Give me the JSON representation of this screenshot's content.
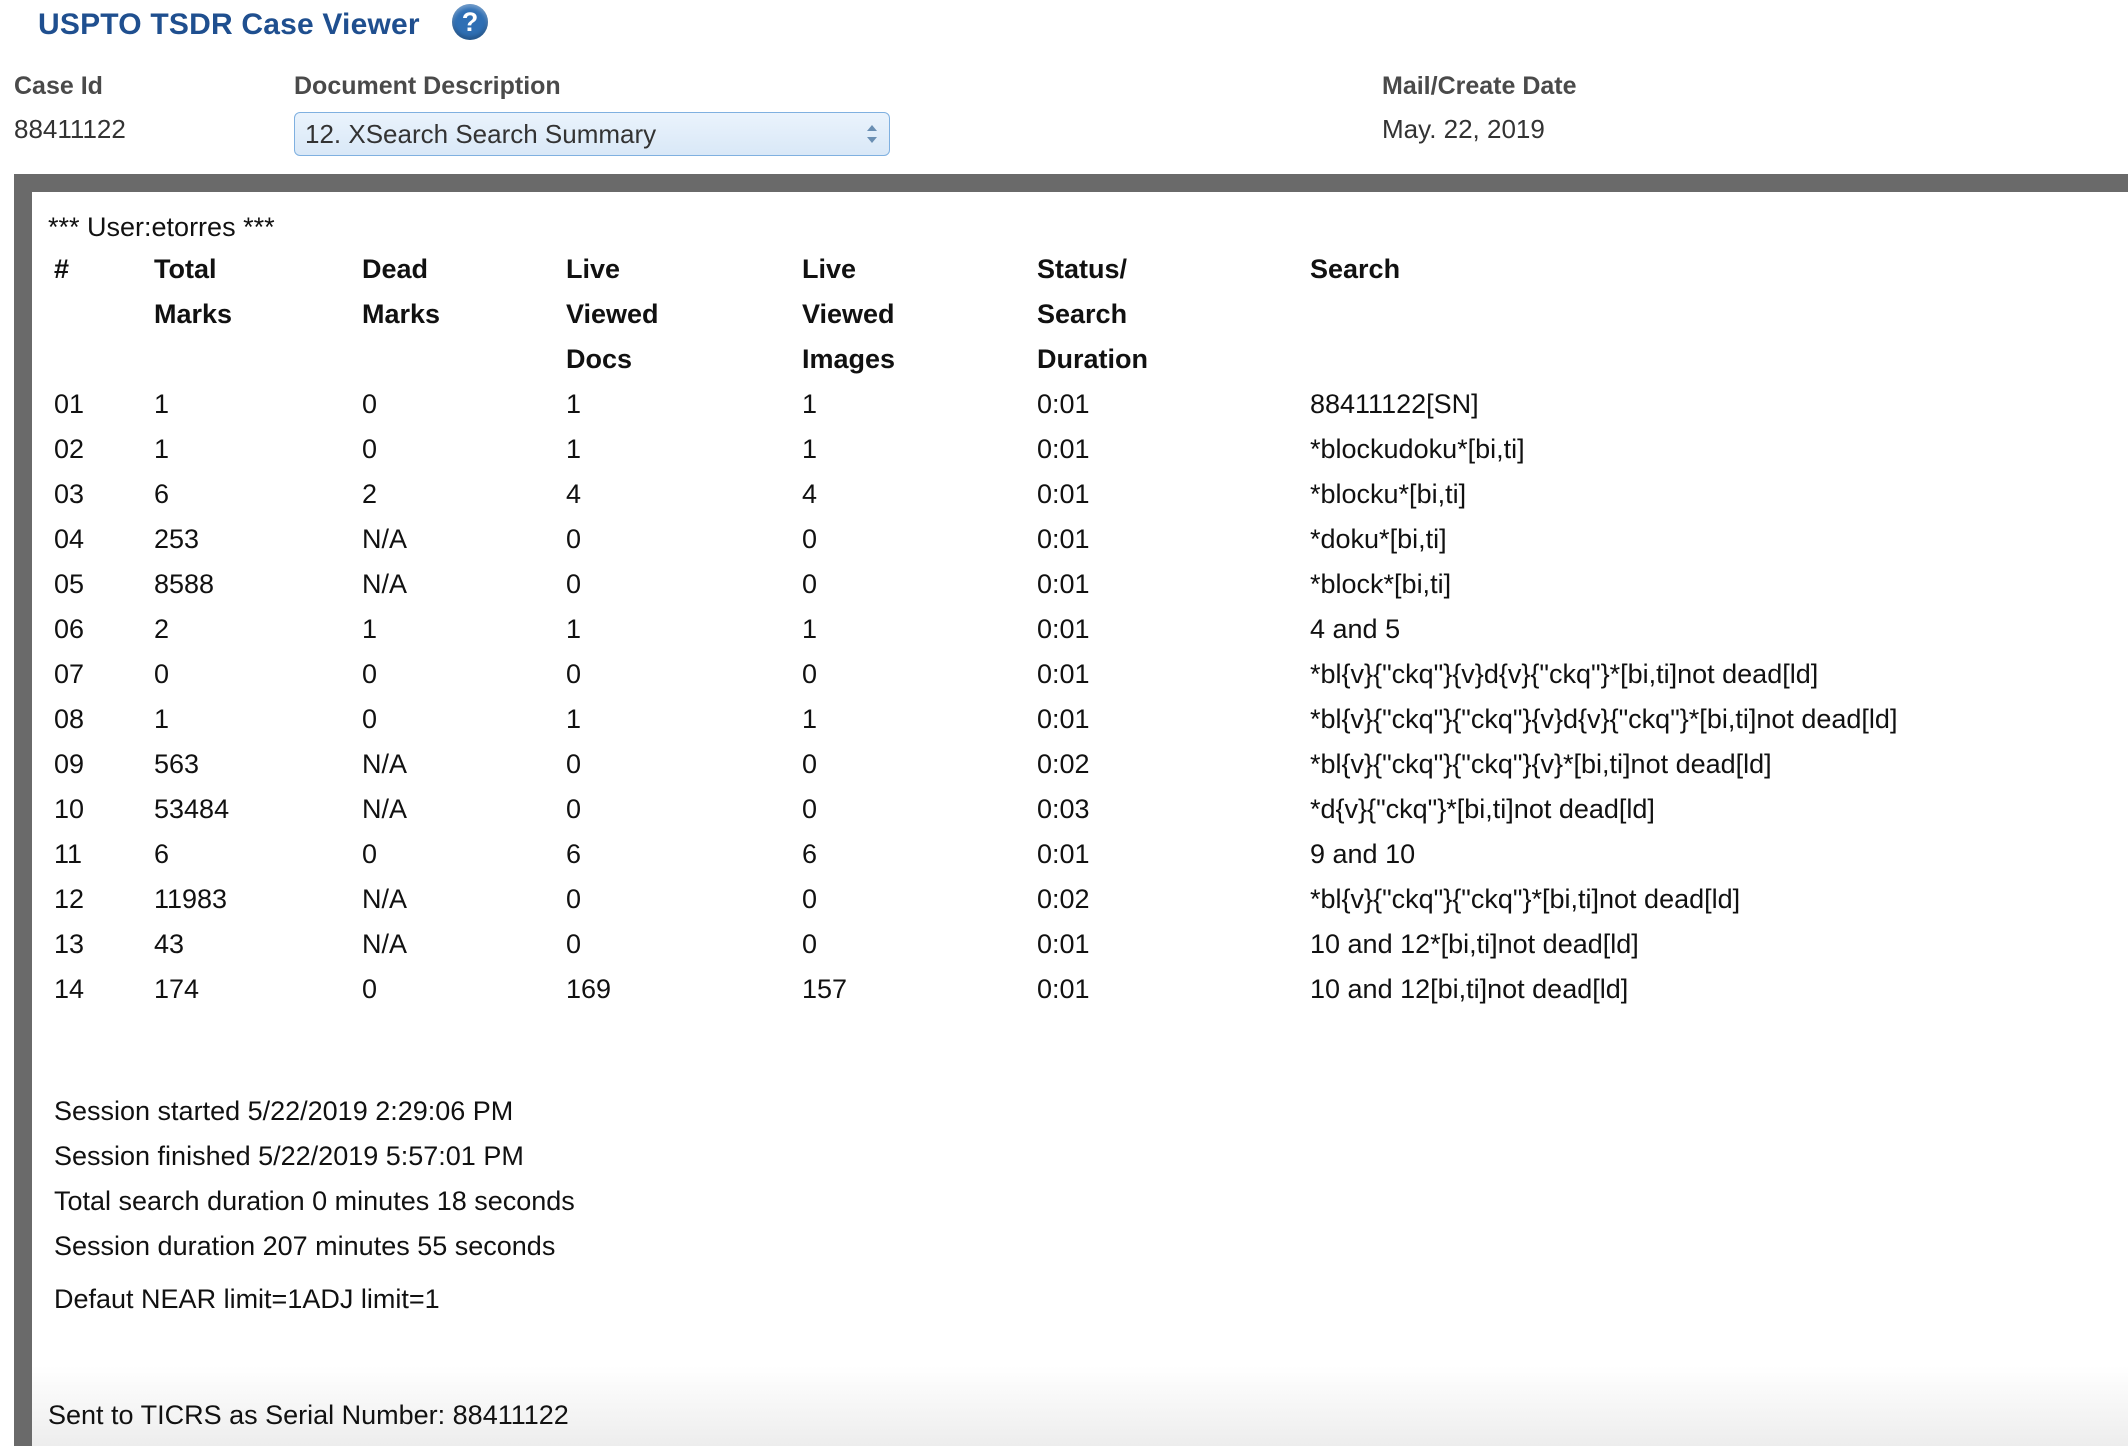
{
  "header": {
    "title": "USPTO TSDR Case Viewer",
    "help_icon": "help-icon",
    "help_glyph": "?"
  },
  "case": {
    "case_id_label": "Case Id",
    "case_id": "88411122",
    "doc_desc_label": "Document Description",
    "doc_desc_selected": "12. XSearch Search Summary",
    "mail_date_label": "Mail/Create Date",
    "mail_date": "May. 22, 2019"
  },
  "document": {
    "user_line": "*** User:etorres ***",
    "columns": [
      [
        "#"
      ],
      [
        "Total",
        "Marks"
      ],
      [
        "Dead",
        "Marks"
      ],
      [
        "Live",
        "Viewed",
        "Docs"
      ],
      [
        "Live",
        "Viewed",
        "Images"
      ],
      [
        "Status/",
        "Search",
        "Duration"
      ],
      [
        "Search"
      ]
    ],
    "rows": [
      [
        "01",
        "1",
        "0",
        "1",
        "1",
        "0:01",
        "88411122[SN]"
      ],
      [
        "02",
        "1",
        "0",
        "1",
        "1",
        "0:01",
        "*blockudoku*[bi,ti]"
      ],
      [
        "03",
        "6",
        "2",
        "4",
        "4",
        "0:01",
        "*blocku*[bi,ti]"
      ],
      [
        "04",
        "253",
        "N/A",
        "0",
        "0",
        "0:01",
        "*doku*[bi,ti]"
      ],
      [
        "05",
        "8588",
        "N/A",
        "0",
        "0",
        "0:01",
        "*block*[bi,ti]"
      ],
      [
        "06",
        "2",
        "1",
        "1",
        "1",
        "0:01",
        "4 and 5"
      ],
      [
        "07",
        "0",
        "0",
        "0",
        "0",
        "0:01",
        "*bl{v}{\"ckq\"}{v}d{v}{\"ckq\"}*[bi,ti]not dead[ld]"
      ],
      [
        "08",
        "1",
        "0",
        "1",
        "1",
        "0:01",
        "*bl{v}{\"ckq\"}{\"ckq\"}{v}d{v}{\"ckq\"}*[bi,ti]not dead[ld]"
      ],
      [
        "09",
        "563",
        "N/A",
        "0",
        "0",
        "0:02",
        "*bl{v}{\"ckq\"}{\"ckq\"}{v}*[bi,ti]not dead[ld]"
      ],
      [
        "10",
        "53484",
        "N/A",
        "0",
        "0",
        "0:03",
        "*d{v}{\"ckq\"}*[bi,ti]not dead[ld]"
      ],
      [
        "11",
        "6",
        "0",
        "6",
        "6",
        "0:01",
        "9 and 10"
      ],
      [
        "12",
        "11983",
        "N/A",
        "0",
        "0",
        "0:02",
        "*bl{v}{\"ckq\"}{\"ckq\"}*[bi,ti]not dead[ld]"
      ],
      [
        "13",
        "43",
        "N/A",
        "0",
        "0",
        "0:01",
        "10 and 12*[bi,ti]not dead[ld]"
      ],
      [
        "14",
        "174",
        "0",
        "169",
        "157",
        "0:01",
        "10 and 12[bi,ti]not dead[ld]"
      ]
    ],
    "session_started": "Session started 5/22/2019 2:29:06 PM",
    "session_finished": "Session finished 5/22/2019 5:57:01 PM",
    "total_search_duration": "Total search duration 0 minutes 18 seconds",
    "session_duration": "Session duration 207 minutes 55 seconds",
    "limits": "Defaut NEAR limit=1ADJ limit=1",
    "sent_to": "Sent to TICRS as Serial Number: 88411122"
  }
}
